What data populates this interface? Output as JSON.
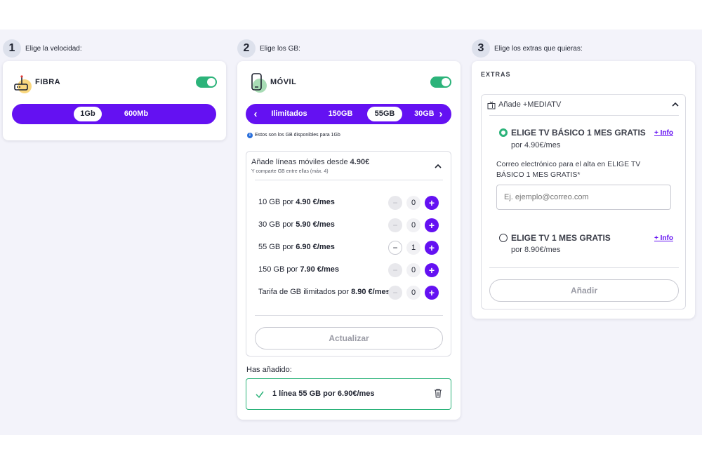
{
  "steps": [
    {
      "num": "1",
      "label": "Elige la velocidad:"
    },
    {
      "num": "2",
      "label": "Elige los GB:"
    },
    {
      "num": "3",
      "label": "Elige los extras que quieras:"
    }
  ],
  "fibra": {
    "title": "FIBRA",
    "toggle_on": true,
    "speeds": [
      "1Gb",
      "600Mb"
    ],
    "selected": "1Gb"
  },
  "movil": {
    "title": "MÓVIL",
    "toggle_on": true,
    "prev_arrow": "‹",
    "next_arrow": "›",
    "gb_options": [
      "Ilimitados",
      "150GB",
      "55GB",
      "30GB"
    ],
    "selected": "55GB",
    "info_note": "Estos son los GB disponibles para 1Gb",
    "add_lines": {
      "title_prefix": "Añade líneas móviles desde",
      "title_price": "4.90€",
      "subtitle": "Y comparte GB entre ellas (máx. 4)",
      "collapse_icon": "⌃",
      "lines": [
        {
          "label": "10 GB por",
          "price": "4.90 €/mes",
          "qty": "0",
          "minus": "−",
          "plus": "+"
        },
        {
          "label": "30 GB por",
          "price": "5.90 €/mes",
          "qty": "0",
          "minus": "−",
          "plus": "+"
        },
        {
          "label": "55 GB por",
          "price": "6.90 €/mes",
          "qty": "1",
          "minus": "−",
          "plus": "+"
        },
        {
          "label": "150 GB por",
          "price": "7.90 €/mes",
          "qty": "0",
          "minus": "−",
          "plus": "+"
        },
        {
          "label": "Tarifa de GB ilimitados por",
          "price": "8.90 €/mes",
          "qty": "0",
          "minus": "−",
          "plus": "+"
        }
      ],
      "update_button": "Actualizar"
    },
    "added_label": "Has añadido:",
    "added_item": "1 línea 55 GB por 6.90€/mes"
  },
  "extras": {
    "title": "EXTRAS",
    "section_title": "Añade +MEDIATV",
    "collapse_icon": "⌃",
    "options": [
      {
        "name": "ELIGE TV BÁSICO 1 MES GRATIS",
        "price": "por 4.90€/mes",
        "info": "+ Info",
        "selected": true
      },
      {
        "name": "ELIGE TV 1 MES GRATIS",
        "price": "por 8.90€/mes",
        "info": "+ Info",
        "selected": false
      }
    ],
    "email_label": "Correo electrónico para el alta en ELIGE TV BÁSICO 1 MES GRATIS*",
    "email_placeholder": "Ej. ejemplo@correo.com",
    "email_value": "",
    "add_button": "Añadir"
  },
  "colors": {
    "accent": "#6411f2",
    "success": "#2cb37a",
    "band": "#f3f3fa"
  }
}
